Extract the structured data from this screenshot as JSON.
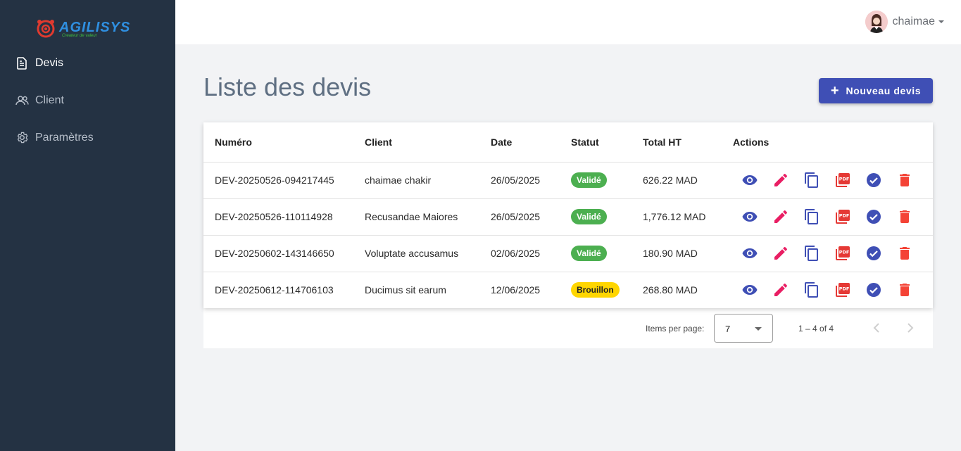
{
  "brand": {
    "name": "AGILISYS",
    "tagline": "Createur de valeur"
  },
  "sidebar": {
    "items": [
      {
        "label": "Devis",
        "icon": "document-icon",
        "active": true
      },
      {
        "label": "Client",
        "icon": "users-icon",
        "active": false
      },
      {
        "label": "Paramètres",
        "icon": "gear-icon",
        "active": false
      }
    ]
  },
  "header": {
    "user_name": "chaimae"
  },
  "main": {
    "title": "Liste des devis",
    "new_button_label": "Nouveau devis"
  },
  "table": {
    "columns": [
      "Numéro",
      "Client",
      "Date",
      "Statut",
      "Total HT",
      "Actions"
    ],
    "rows": [
      {
        "numero": "DEV-20250526-094217445",
        "client": "chaimae chakir",
        "date": "26/05/2025",
        "statut": "Validé",
        "total": "626.22 MAD"
      },
      {
        "numero": "DEV-20250526-110114928",
        "client": "Recusandae Maiores",
        "date": "26/05/2025",
        "statut": "Validé",
        "total": "1,776.12 MAD"
      },
      {
        "numero": "DEV-20250602-143146650",
        "client": "Voluptate accusamus",
        "date": "02/06/2025",
        "statut": "Validé",
        "total": "180.90 MAD"
      },
      {
        "numero": "DEV-20250612-114706103",
        "client": "Ducimus sit earum",
        "date": "12/06/2025",
        "statut": "Brouillon",
        "total": "268.80 MAD"
      }
    ],
    "action_icons": [
      "eye-icon",
      "pencil-icon",
      "copy-icon",
      "pdf-icon",
      "check-circle-icon",
      "trash-icon"
    ]
  },
  "paginator": {
    "items_per_page_label": "Items per page:",
    "items_per_page_value": "7",
    "range_label": "1 – 4 of 4"
  },
  "colors": {
    "sidebar_bg": "#243243",
    "primary": "#3f4fb5",
    "validated": "#4caf50",
    "draft": "#ffd600",
    "edit": "#e91e63",
    "delete": "#f44336",
    "pdf": "#e53935"
  }
}
